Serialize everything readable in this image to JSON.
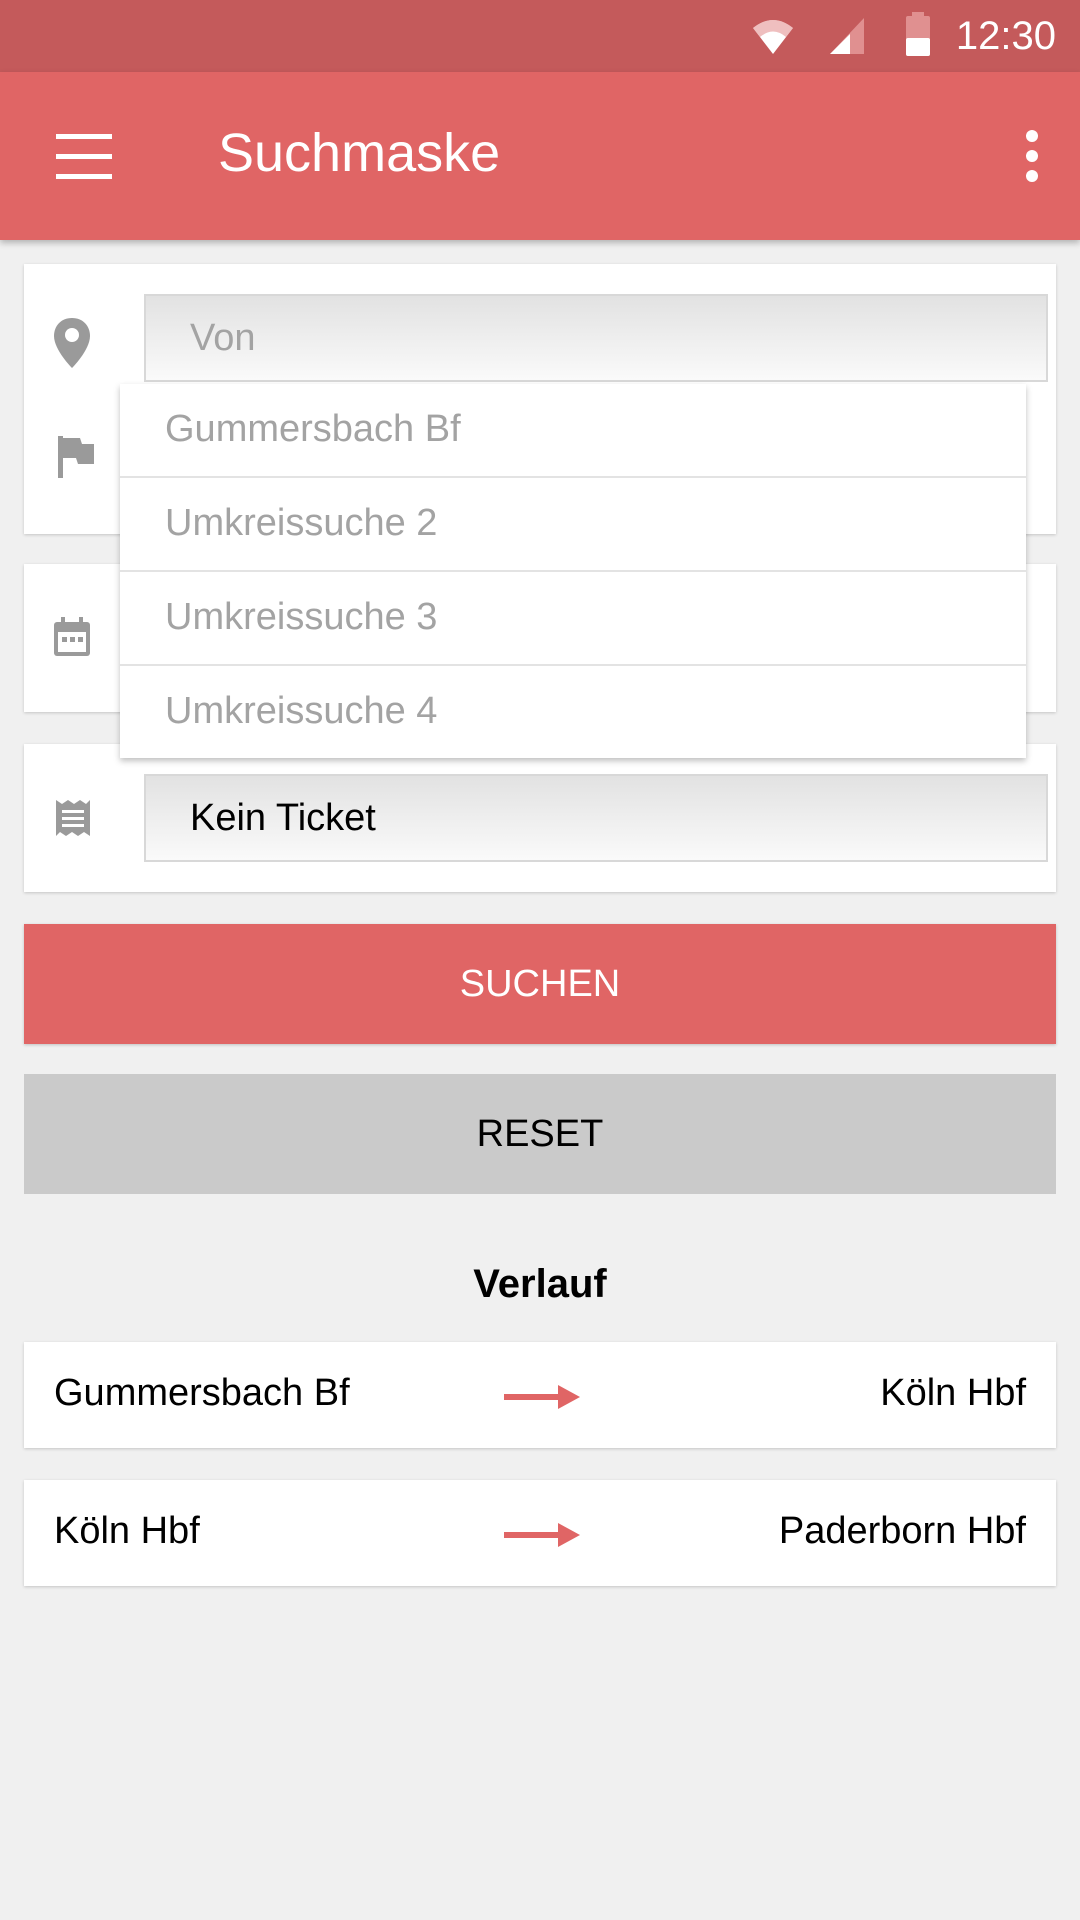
{
  "status_bar": {
    "time": "12:30"
  },
  "app_bar": {
    "title": "Suchmaske"
  },
  "search": {
    "from_placeholder": "Von",
    "suggestions": [
      "Gummersbach Bf",
      "Umkreissuche 2",
      "Umkreissuche 3",
      "Umkreissuche 4"
    ],
    "ticket_value": "Kein Ticket"
  },
  "buttons": {
    "search": "SUCHEN",
    "reset": "RESET"
  },
  "history": {
    "heading": "Verlauf",
    "items": [
      {
        "from": "Gummersbach Bf",
        "to": "Köln Hbf"
      },
      {
        "from": "Köln Hbf",
        "to": "Paderborn Hbf"
      }
    ]
  },
  "colors": {
    "primary": "#e06565",
    "status_bar": "#c45a5b",
    "secondary_button": "#cacaca",
    "background": "#f0f0f0"
  },
  "icons": [
    "menu-icon",
    "more-vert-icon",
    "wifi-icon",
    "signal-icon",
    "battery-icon",
    "location-pin-icon",
    "flag-icon",
    "calendar-icon",
    "ticket-icon",
    "arrow-right-icon"
  ]
}
